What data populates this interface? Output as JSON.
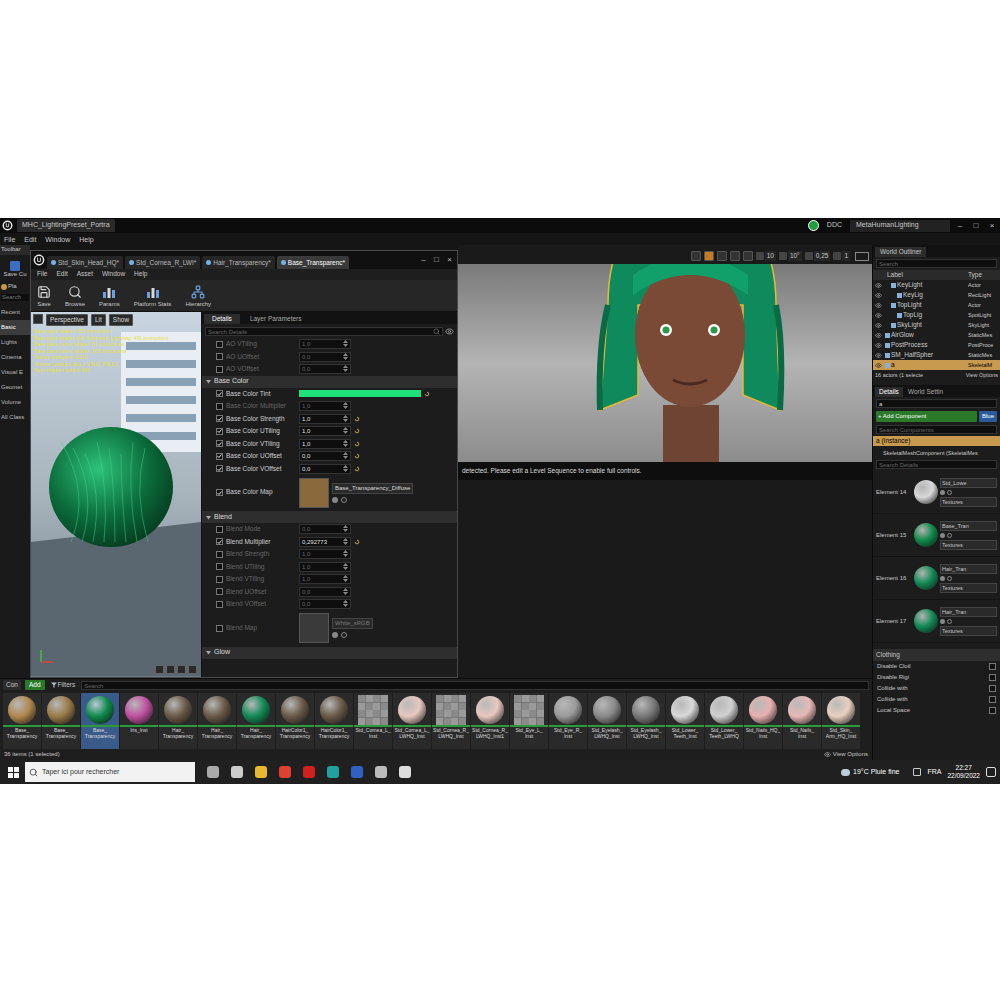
{
  "title_bar": {
    "tab": "MHC_LightingPreset_Portra",
    "ddc": "DDC",
    "project": "MetaHumanLighting",
    "controls": [
      "–",
      "□",
      "×"
    ]
  },
  "menu": [
    "File",
    "Edit",
    "Window",
    "Help"
  ],
  "place_panel": {
    "toolbar_tab": "Toolbar",
    "save": "Save Cu",
    "place": "Pla",
    "search": "Search",
    "categories": [
      {
        "label": "Recent",
        "selected": false
      },
      {
        "label": "Basic",
        "selected": true
      },
      {
        "label": "Lights",
        "selected": false
      },
      {
        "label": "Cinema",
        "selected": false
      },
      {
        "label": "Visual E",
        "selected": false
      },
      {
        "label": "Geomet",
        "selected": false
      },
      {
        "label": "Volume",
        "selected": false
      },
      {
        "label": "All Class",
        "selected": false
      }
    ]
  },
  "material_editor": {
    "tabs": [
      {
        "label": "Std_Skin_Head_HQ*",
        "selected": false
      },
      {
        "label": "Std_Cornea_R_LWI*",
        "selected": false
      },
      {
        "label": "Hair_Transparency*",
        "selected": false
      },
      {
        "label": "Base_Transparenc*",
        "selected": true
      }
    ],
    "window_controls": [
      "–",
      "□",
      "×"
    ],
    "menu": [
      "File",
      "Edit",
      "Asset",
      "Window",
      "Help"
    ],
    "toolbar": [
      "Save",
      "Browse",
      "Params",
      "Platform Stats",
      "Hierarchy"
    ],
    "viewport": {
      "buttons": [
        "Perspective",
        "Lit",
        "Show"
      ],
      "stats": [
        "Base pass shader: 303 instructions",
        "Base pass shader with Volumetric Lightmap: 491 instructions",
        "Base pass vertex shader: 51 instructions",
        "Base pass vertex shader: 160 instructions",
        "Texture samplers: 10/16",
        "Texture Lookups (Est.): VS(0), PS(13)",
        "Num shaders added: 868"
      ]
    },
    "details": {
      "tabs": [
        {
          "label": "Details",
          "selected": true
        },
        {
          "label": "Layer Parameters",
          "selected": false
        }
      ],
      "search": "Search Details",
      "rows": [
        {
          "kind": "number",
          "label": "AO VTiling",
          "checked": false,
          "value": "1,0"
        },
        {
          "kind": "number",
          "label": "AO UOffset",
          "checked": false,
          "value": "0,0"
        },
        {
          "kind": "number",
          "label": "AO VOffset",
          "checked": false,
          "value": "0,0"
        },
        {
          "kind": "section",
          "label": "Base Color"
        },
        {
          "kind": "color",
          "label": "Base Color Tint",
          "checked": true,
          "color": "#1fe07a"
        },
        {
          "kind": "number",
          "label": "Base Color Multiplier",
          "checked": false,
          "value": "1,0"
        },
        {
          "kind": "number",
          "label": "Base Color Strength",
          "checked": true,
          "value": "1,0"
        },
        {
          "kind": "number",
          "label": "Base Color UTiling",
          "checked": true,
          "value": "1,0"
        },
        {
          "kind": "number",
          "label": "Base Color VTiling",
          "checked": true,
          "value": "1,0"
        },
        {
          "kind": "number",
          "label": "Base Color UOffset",
          "checked": true,
          "value": "0,0"
        },
        {
          "kind": "number",
          "label": "Base Color VOffset",
          "checked": true,
          "value": "0,0"
        },
        {
          "kind": "texture",
          "label": "Base Color Map",
          "checked": true,
          "value": "Base_Transparency_Diffuse",
          "color": "#8a6a3c"
        },
        {
          "kind": "section",
          "label": "Blend"
        },
        {
          "kind": "number",
          "label": "Blend Mode",
          "checked": false,
          "value": "0,0"
        },
        {
          "kind": "number",
          "label": "Blend Multiplier",
          "checked": true,
          "value": "0,292773"
        },
        {
          "kind": "number",
          "label": "Blend Strength",
          "checked": false,
          "value": "1,0"
        },
        {
          "kind": "number",
          "label": "Blend UTiling",
          "checked": false,
          "value": "1,0"
        },
        {
          "kind": "number",
          "label": "Blend VTiling",
          "checked": false,
          "value": "1,0"
        },
        {
          "kind": "number",
          "label": "Blend UOffset",
          "checked": false,
          "value": "0,0"
        },
        {
          "kind": "number",
          "label": "Blend VOffset",
          "checked": false,
          "value": "0,0"
        },
        {
          "kind": "texture",
          "label": "Blend Map",
          "checked": false,
          "value": "White_sRGB",
          "color": "#3a3a3a"
        },
        {
          "kind": "section",
          "label": "Glow"
        }
      ]
    }
  },
  "viewport": {
    "toolbar": [
      "10",
      "10°",
      "0,25",
      "1"
    ],
    "message": "detected. Please edit a Level Sequence to enable full controls."
  },
  "content_browser": {
    "tab": "Con",
    "add": "Add",
    "filters": "Filters",
    "search": "Search",
    "items": [
      {
        "label": [
          "Base_",
          "Transparency"
        ],
        "kind": "sphere",
        "color": "#b08850",
        "selected": false
      },
      {
        "label": [
          "Base_",
          "Transparency"
        ],
        "kind": "sphere",
        "color": "#9a7a48",
        "selected": false
      },
      {
        "label": [
          "Base_",
          "Transparency"
        ],
        "kind": "sphere",
        "color": "#0f8a4a",
        "selected": true
      },
      {
        "label": [
          "Iris_Inst",
          ""
        ],
        "kind": "sphere",
        "color": "#c050a0",
        "selected": false
      },
      {
        "label": [
          "Hair_",
          "Transparency"
        ],
        "kind": "sphere",
        "color": "#6a5a48",
        "selected": false
      },
      {
        "label": [
          "Hair_",
          "Transparency"
        ],
        "kind": "sphere",
        "color": "#6a5a48",
        "selected": false
      },
      {
        "label": [
          "Hair_",
          "Transparency"
        ],
        "kind": "sphere",
        "color": "#128a56",
        "selected": false
      },
      {
        "label": [
          "HairColor1_",
          "Transparency"
        ],
        "kind": "sphere",
        "color": "#6a5a48",
        "selected": false
      },
      {
        "label": [
          "HairColor1_",
          "Transparency"
        ],
        "kind": "sphere",
        "color": "#6a5a48",
        "selected": false
      },
      {
        "label": [
          "Std_Cornea_L_",
          "Inst"
        ],
        "kind": "checker",
        "color": "#8a8a8a",
        "selected": false
      },
      {
        "label": [
          "Std_Cornea_L_",
          "LWHQ_Inst"
        ],
        "kind": "sphere",
        "color": "#e8c8c0",
        "selected": false
      },
      {
        "label": [
          "Std_Cornea_R_",
          "LWHQ_Inst"
        ],
        "kind": "checker",
        "color": "#8a8a8a",
        "selected": false
      },
      {
        "label": [
          "Std_Cornea_R_",
          "LWHQ_Inst1"
        ],
        "kind": "sphere",
        "color": "#e8c8c0",
        "selected": false
      },
      {
        "label": [
          "Std_Eye_L_",
          "Inst"
        ],
        "kind": "checker",
        "color": "#8a8a8a",
        "selected": false
      },
      {
        "label": [
          "Std_Eye_R_",
          "Inst"
        ],
        "kind": "sphere",
        "color": "#9a9a9a",
        "selected": false
      },
      {
        "label": [
          "Std_Eyelash_",
          "LWHQ_Inst"
        ],
        "kind": "sphere",
        "color": "#8a8a8a",
        "selected": false
      },
      {
        "label": [
          "Std_Eyelash_",
          "LWHQ_Inst"
        ],
        "kind": "sphere",
        "color": "#7a7a7a",
        "selected": false
      },
      {
        "label": [
          "Std_Lower_",
          "Teeth_Inst"
        ],
        "kind": "sphere",
        "color": "#d8d8d8",
        "selected": false
      },
      {
        "label": [
          "Std_Lower_",
          "Teeth_LWHQ"
        ],
        "kind": "sphere",
        "color": "#d0d0d0",
        "selected": false
      },
      {
        "label": [
          "Std_Nails_HQ_",
          "Inst"
        ],
        "kind": "sphere",
        "color": "#e8b0b0",
        "selected": false
      },
      {
        "label": [
          "Std_Nails_",
          "Inst"
        ],
        "kind": "sphere",
        "color": "#e8b8b8",
        "selected": false
      },
      {
        "label": [
          "Std_Skin_",
          "Arm_HQ_Inst"
        ],
        "kind": "sphere",
        "color": "#e8cfc0",
        "selected": false
      }
    ],
    "status": "36 items (1 selected)",
    "view_options": "View Options"
  },
  "world_outliner": {
    "title": "World Outliner",
    "search": "Search",
    "columns": [
      "Label",
      "Type"
    ],
    "rows": [
      {
        "label": "KeyLight",
        "type": "Actor",
        "depth": 1,
        "selected": false
      },
      {
        "label": "KeyLig",
        "type": "RectLight",
        "depth": 2,
        "selected": false
      },
      {
        "label": "TopLight",
        "type": "Actor",
        "depth": 1,
        "selected": false
      },
      {
        "label": "TopLig",
        "type": "SpotLight",
        "depth": 2,
        "selected": false
      },
      {
        "label": "SkyLight",
        "type": "SkyLight",
        "depth": 1,
        "selected": false
      },
      {
        "label": "AirGlow",
        "type": "StaticMes",
        "depth": 0,
        "selected": false
      },
      {
        "label": "PostProcess",
        "type": "PostProce",
        "depth": 0,
        "selected": false
      },
      {
        "label": "SM_HalfSpher",
        "type": "StaticMes",
        "depth": 0,
        "selected": false
      },
      {
        "label": "a",
        "type": "SkeletalM",
        "depth": 0,
        "selected": true
      }
    ],
    "status": "16 actors (1 selecte",
    "view_options": "View Options"
  },
  "details": {
    "tabs": [
      {
        "label": "Details",
        "selected": true
      },
      {
        "label": "World Settin",
        "selected": false
      }
    ],
    "search": "a",
    "add_component": "+ Add Component",
    "blueprint": "Blue",
    "search_components": "Search Components",
    "instance": "a (Instance)",
    "component": "SkeletalMeshComponent (SkeletalMes",
    "search_details": "Search Details",
    "elements": [
      {
        "label": "Element 14",
        "material": "Std_Lowe",
        "textures": "Textures",
        "color": "#d8d8d8"
      },
      {
        "label": "Element 15",
        "material": "Base_Tran",
        "textures": "Textures",
        "color": "#0f8a4a"
      },
      {
        "label": "Element 16",
        "material": "Hair_Tran",
        "textures": "Textures",
        "color": "#128a56"
      },
      {
        "label": "Element 17",
        "material": "Hair_Tran",
        "textures": "Textures",
        "color": "#128a56"
      }
    ],
    "clothing": {
      "title": "Clothing",
      "rows": [
        {
          "label": "Disable Clotl",
          "checked": false
        },
        {
          "label": "Disable Rigi",
          "checked": false
        },
        {
          "label": "Collide with",
          "checked": false
        },
        {
          "label": "Collide with",
          "checked": false
        },
        {
          "label": "Local Space",
          "checked": false
        }
      ]
    }
  },
  "taskbar": {
    "search": "Taper ici pour rechercher",
    "weather": "19°C Pluie fine",
    "language": "FRA",
    "time": "22:27",
    "date": "22/09/2022"
  }
}
